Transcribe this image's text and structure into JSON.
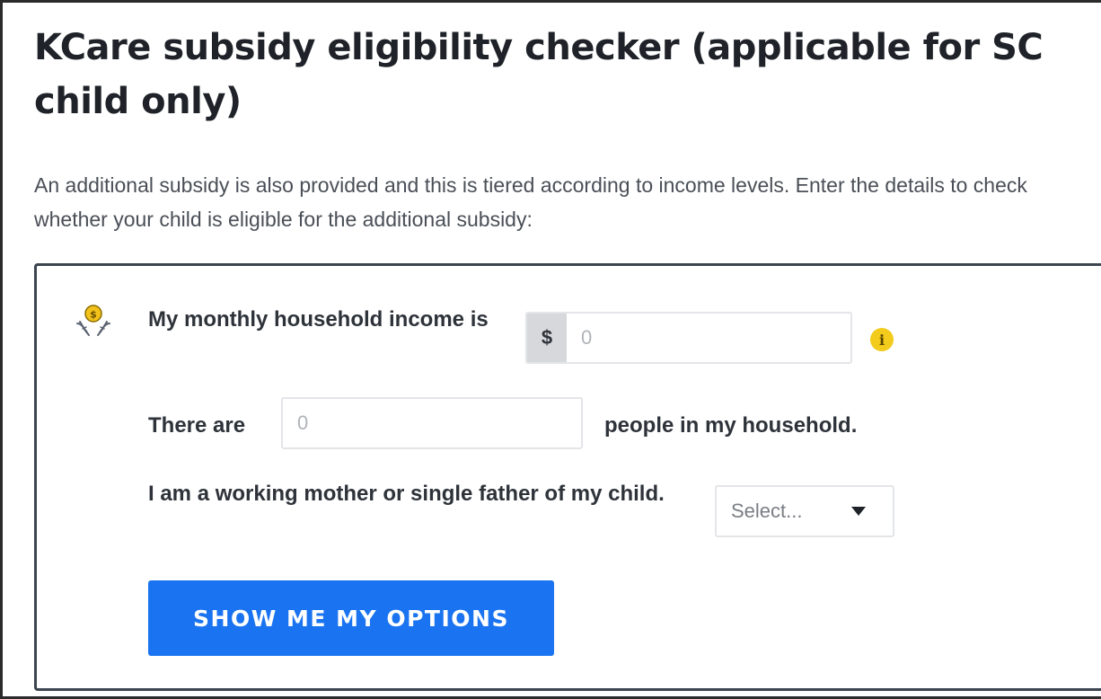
{
  "page": {
    "title": "KCare subsidy eligibility checker (applicable for SC child only)",
    "intro": "An additional subsidy is also provided and this is tiered according to income levels. Enter the details to check whether your child is eligible for the additional subsidy:"
  },
  "form": {
    "income": {
      "label": "My monthly household income is",
      "currency_symbol": "$",
      "placeholder": "0",
      "icon": "hand-coin-icon",
      "info_icon": "info-icon",
      "info_glyph": "i"
    },
    "household": {
      "label_before": "There are",
      "placeholder": "0",
      "label_after": "people in my household."
    },
    "working_parent": {
      "label": "I am a working mother or single father of my child.",
      "select_value": "Select...",
      "caret_icon": "caret-down-icon"
    },
    "submit_label": "SHOW ME MY OPTIONS"
  },
  "colors": {
    "button": "#1a73f0",
    "info": "#f2cb1d",
    "icon_gold": "#f2c21b"
  }
}
